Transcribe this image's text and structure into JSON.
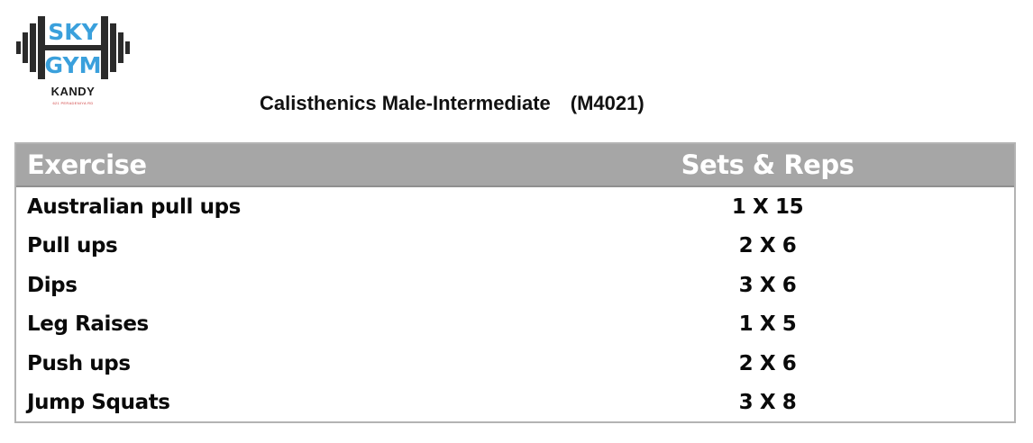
{
  "logo": {
    "line1": "SKY",
    "line2": "GYM",
    "location": "KANDY",
    "tagline": "621 PERADENIYA RD",
    "colors": {
      "text": "#3aa0dc",
      "bar": "#2b2b2b"
    }
  },
  "title": {
    "name": "Calisthenics Male-Intermediate",
    "code": "(M4021)"
  },
  "table": {
    "header_bg": "#a6a6a6",
    "columns": {
      "exercise": "Exercise",
      "sets_reps": "Sets & Reps"
    },
    "rows": [
      {
        "exercise": "Australian pull ups",
        "sets_reps": "1 X 15"
      },
      {
        "exercise": "Pull ups",
        "sets_reps": "2 X 6"
      },
      {
        "exercise": "Dips",
        "sets_reps": "3 X 6"
      },
      {
        "exercise": "Leg Raises",
        "sets_reps": "1 X 5"
      },
      {
        "exercise": "Push ups",
        "sets_reps": "2 X 6"
      },
      {
        "exercise": "Jump Squats",
        "sets_reps": "3 X 8"
      }
    ]
  }
}
